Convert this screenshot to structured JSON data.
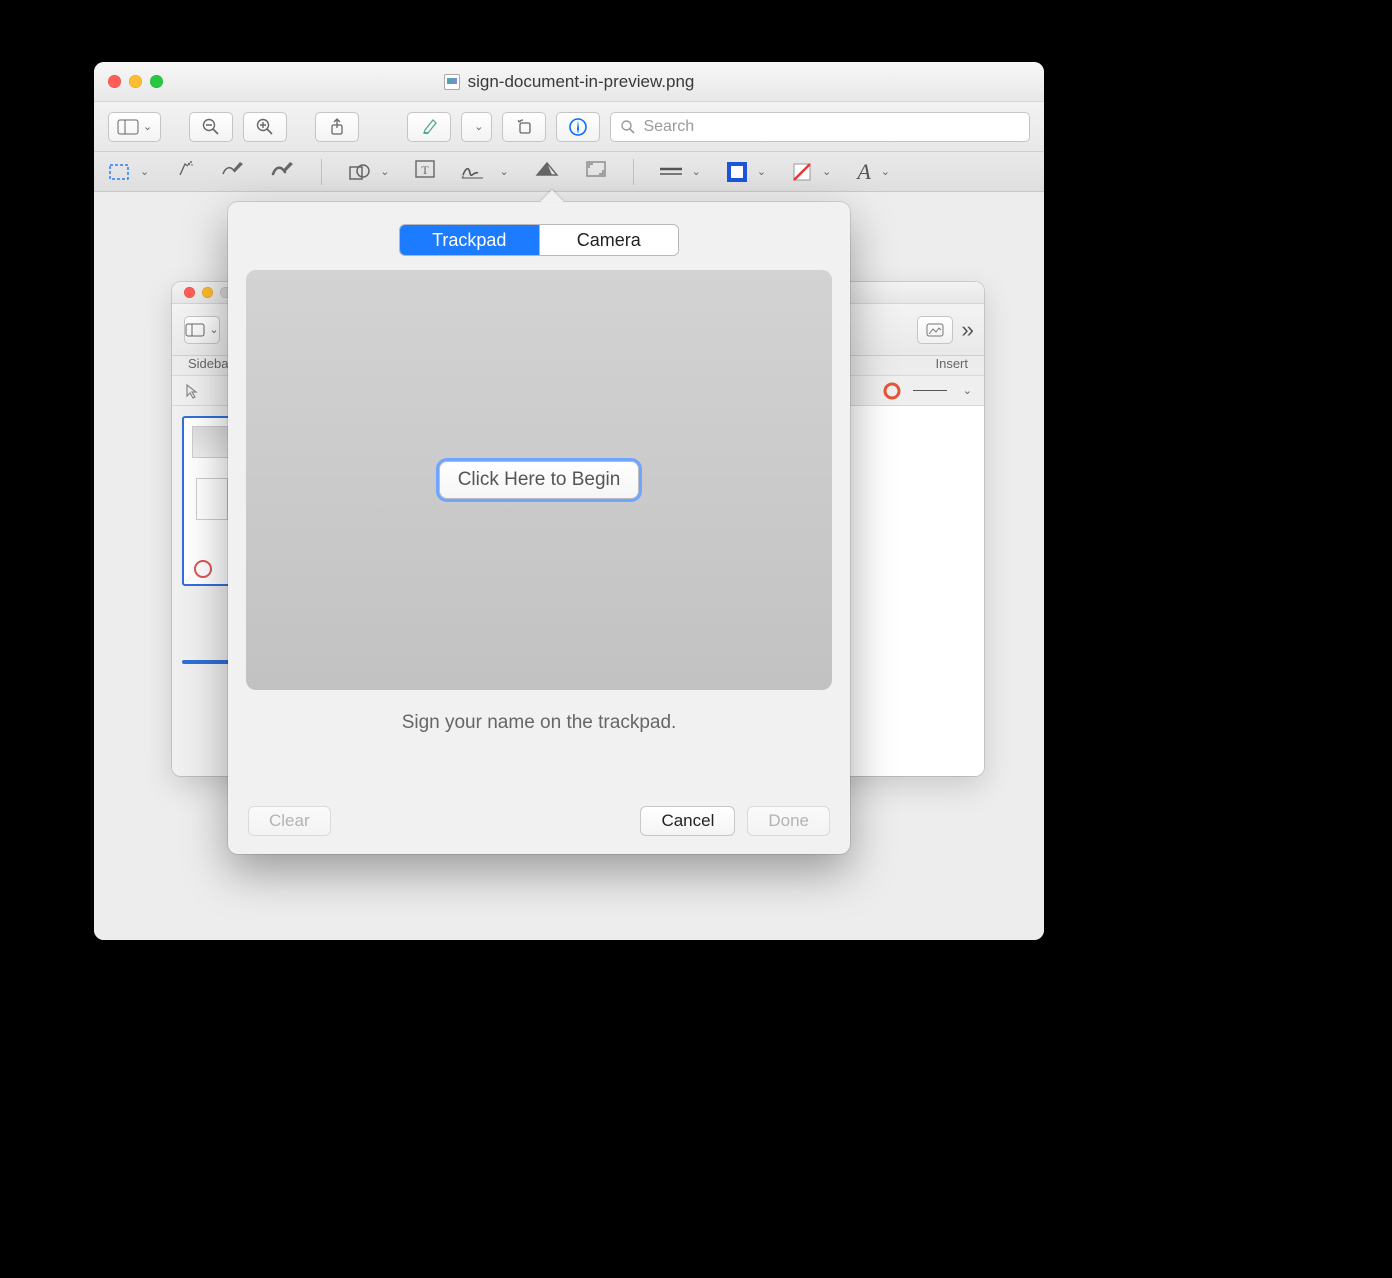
{
  "window": {
    "title": "sign-document-in-preview.png"
  },
  "toolbar": {
    "search_placeholder": "Search"
  },
  "inner_window": {
    "sidebar_label": "Sidebar",
    "insert_label": "Insert"
  },
  "popover": {
    "tabs": {
      "trackpad": "Trackpad",
      "camera": "Camera"
    },
    "begin_label": "Click Here to Begin",
    "hint": "Sign your name on the trackpad.",
    "clear": "Clear",
    "cancel": "Cancel",
    "done": "Done"
  }
}
